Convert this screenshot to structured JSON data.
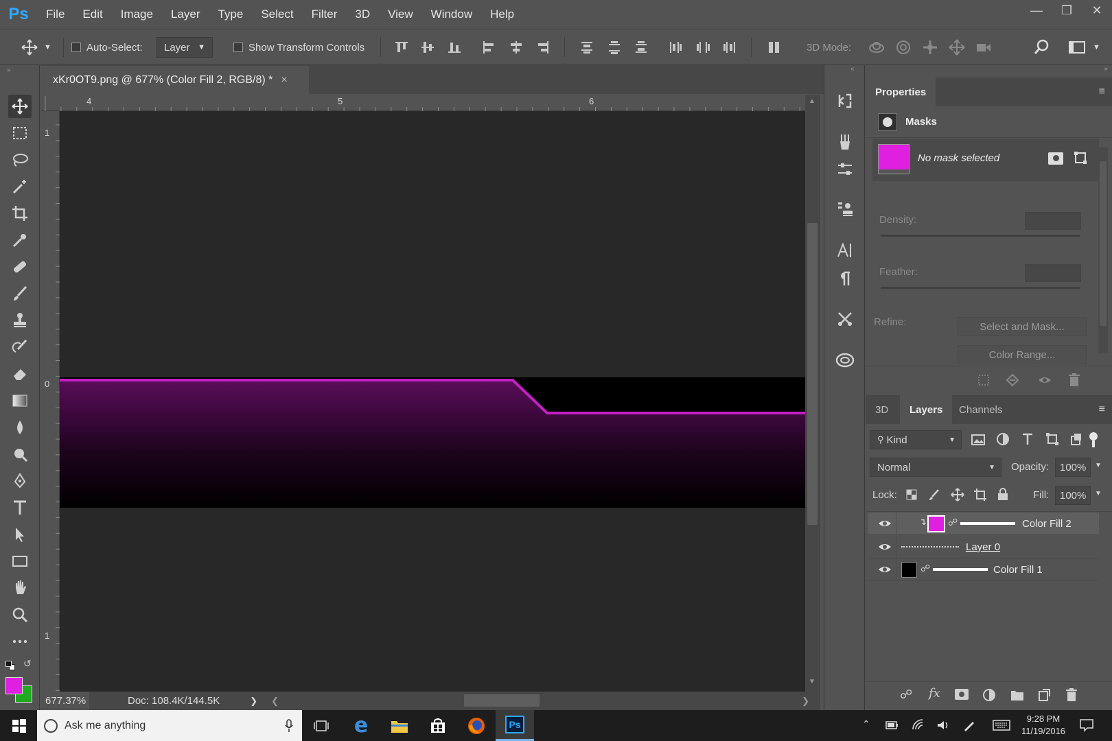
{
  "app": {
    "logo": "Ps",
    "menu": [
      "File",
      "Edit",
      "Image",
      "Layer",
      "Type",
      "Select",
      "Filter",
      "3D",
      "View",
      "Window",
      "Help"
    ]
  },
  "options_bar": {
    "auto_select_label": "Auto-Select:",
    "auto_select_value": "Layer",
    "show_transform_label": "Show Transform Controls",
    "mode_3d_label": "3D Mode:"
  },
  "document": {
    "tab_title": "xKr0OT9.png @ 677% (Color Fill 2, RGB/8) *",
    "close_glyph": "×",
    "ruler_top_labels": [
      "4",
      "5",
      "6"
    ],
    "ruler_left_labels": [
      "1",
      "0",
      "1"
    ]
  },
  "status_bar": {
    "zoom": "677.37%",
    "doc_info": "Doc: 108.4K/144.5K"
  },
  "colors": {
    "foreground": "#e020e0",
    "background": "#1faa1f",
    "accent_magenta": "#c41fc4"
  },
  "properties": {
    "tab_label": "Properties",
    "section_label": "Masks",
    "no_mask_text": "No mask selected",
    "density_label": "Density:",
    "feather_label": "Feather:",
    "refine_label": "Refine:",
    "select_mask_button": "Select and Mask...",
    "color_range_button": "Color Range..."
  },
  "layers_panel": {
    "tabs": [
      "3D",
      "Layers",
      "Channels"
    ],
    "kind_filter": "Kind",
    "blend_mode": "Normal",
    "opacity_label": "Opacity:",
    "opacity_value": "100%",
    "lock_label": "Lock:",
    "fill_label": "Fill:",
    "fill_value": "100%",
    "layers": [
      {
        "name": "Color Fill 2",
        "swatch": "#e020e0",
        "selected": true
      },
      {
        "name": "Layer 0",
        "swatch": "",
        "selected": false
      },
      {
        "name": "Color Fill 1",
        "swatch": "#000000",
        "selected": false
      }
    ]
  },
  "taskbar": {
    "search_placeholder": "Ask me anything",
    "time": "9:28 PM",
    "date": "11/19/2016"
  }
}
